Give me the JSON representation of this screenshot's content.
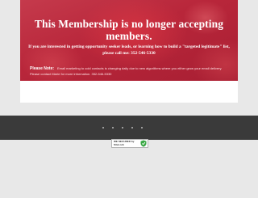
{
  "hero": {
    "headline": "This Membership is  no longer accepting members.",
    "subtext": "If you are interested in getting opportunity seeker leads, or learning how to build a \"targeted legitimate\" list, please call me:  352-546-5330",
    "note_label": "Please Note:",
    "note_text": "Email marketing to cold contacts is changing daily due to new algorithms where you either grow your email delivery. Please contact Marie for more information. 352-546-5330"
  },
  "badge": {
    "text": "WE SECURED by SiteLock",
    "icon": "shield-icon",
    "icon_color": "#3aa845"
  },
  "colors": {
    "hero_red": "#b8263a",
    "footer": "#3a3a3a",
    "background": "#e8e8e8"
  }
}
